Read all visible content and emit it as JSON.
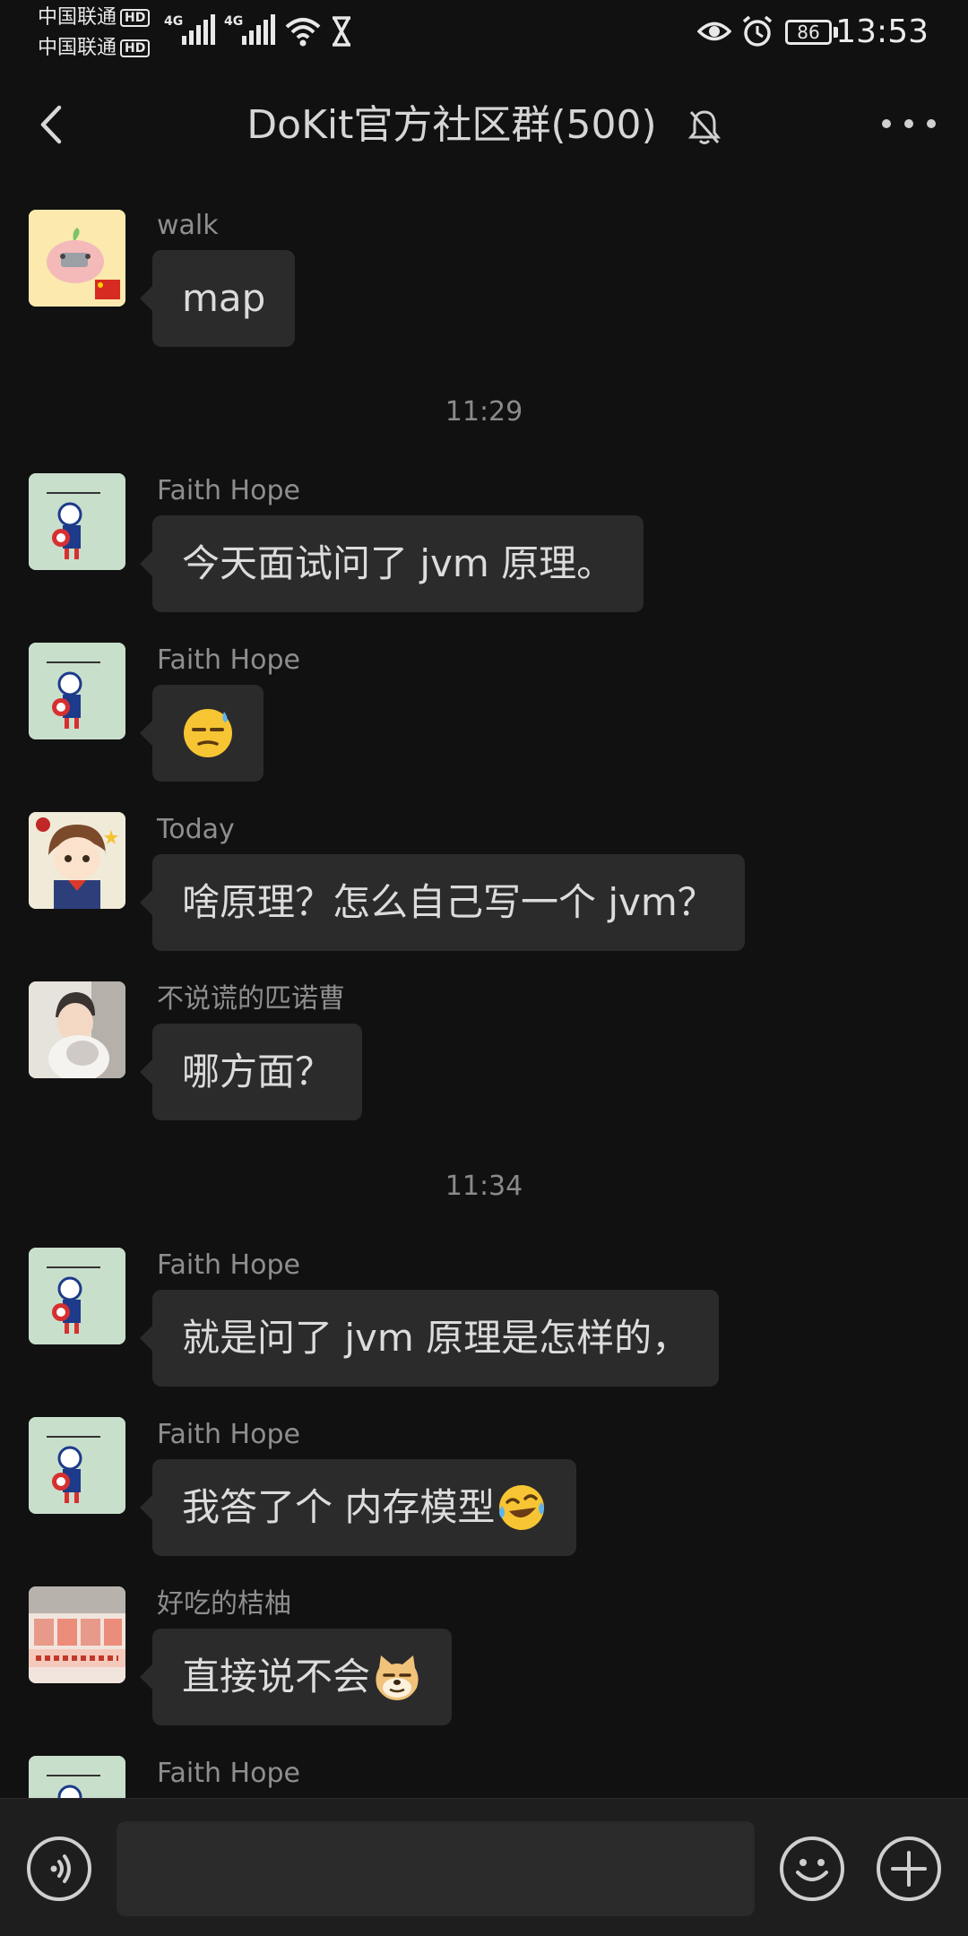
{
  "status_bar": {
    "carrier_1": "中国联通",
    "carrier_2": "中国联通",
    "hd_label": "HD",
    "network_1": "4G",
    "network_2": "4G",
    "battery_level": "86",
    "time": "13:53"
  },
  "header": {
    "title": "DoKit官方社区群(500)",
    "back_icon": "back-chevron-icon",
    "mute_icon": "bell-muted-icon",
    "more_icon": "more-dots-icon"
  },
  "messages": [
    {
      "sender": "walk",
      "text": "map",
      "emoji": null
    },
    {
      "sender": "Faith Hope",
      "text": "今天面试问了 jvm 原理。",
      "emoji": null
    },
    {
      "sender": "Faith Hope",
      "text": "",
      "emoji": "sweat-smile-emoji"
    },
    {
      "sender": "Today",
      "text": "啥原理？怎么自己写一个 jvm？",
      "emoji": null
    },
    {
      "sender": "不说谎的匹诺曹",
      "text": "哪方面？",
      "emoji": null
    },
    {
      "sender": "Faith Hope",
      "text": "就是问了 jvm 原理是怎样的，",
      "emoji": null
    },
    {
      "sender": "Faith Hope",
      "text": "我答了个 内存模型",
      "emoji": "laugh-cry-emoji"
    },
    {
      "sender": "好吃的桔柚",
      "text": "直接说不会",
      "emoji": "doge-emoji"
    },
    {
      "sender": "Faith Hope",
      "text": "",
      "emoji": null
    }
  ],
  "timestamps": [
    "11:29",
    "11:34"
  ],
  "input_bar": {
    "voice_icon": "voice-icon",
    "input_value": "",
    "emoji_icon": "emoji-icon",
    "plus_icon": "plus-icon"
  }
}
